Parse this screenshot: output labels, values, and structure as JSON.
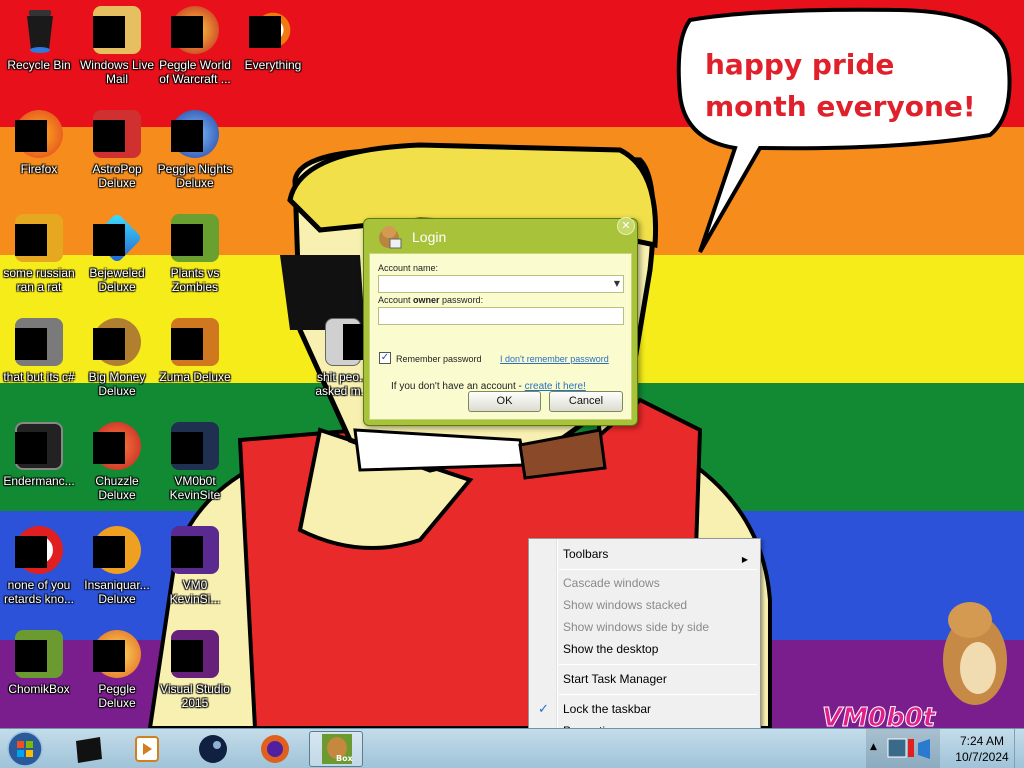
{
  "wallpaper": {
    "speech_bubble": "happy pride month everyone!",
    "watermark": "VM0b0t",
    "stripe_colors": [
      "#e8101a",
      "#f58c1c",
      "#f5ec1a",
      "#128a34",
      "#2b52d8",
      "#7a1e8e"
    ]
  },
  "desktop_icons": [
    {
      "label": "Recycle Bin",
      "icon": "recycle-bin-icon"
    },
    {
      "label": "Windows Live Mail",
      "icon": "windows-live-mail-icon"
    },
    {
      "label": "Peggle World of Warcraft ...",
      "icon": "peggle-wow-icon"
    },
    {
      "label": "Everything",
      "icon": "everything-search-icon"
    },
    {
      "label": "Firefox",
      "icon": "firefox-icon"
    },
    {
      "label": "AstroPop Deluxe",
      "icon": "astropop-icon"
    },
    {
      "label": "Peggle Nights Deluxe",
      "icon": "peggle-nights-icon"
    },
    {
      "label": "some russian ran a rat",
      "icon": "shortcut-icon"
    },
    {
      "label": "Bejeweled Deluxe",
      "icon": "bejeweled-icon"
    },
    {
      "label": "Plants vs Zombies",
      "icon": "plants-vs-zombies-icon"
    },
    {
      "label": "that but its c#",
      "icon": "shortcut-icon"
    },
    {
      "label": "Big Money Deluxe",
      "icon": "big-money-icon"
    },
    {
      "label": "Zuma Deluxe",
      "icon": "zuma-icon"
    },
    {
      "label": "Endermanc...",
      "icon": "console-icon"
    },
    {
      "label": "Chuzzle Deluxe",
      "icon": "chuzzle-icon"
    },
    {
      "label": "VM0b0t KevinSite",
      "icon": "website-icon"
    },
    {
      "label": "none of you retards kno...",
      "icon": "shortcut-icon"
    },
    {
      "label": "Insaniquar... Deluxe",
      "icon": "insaniquarium-icon"
    },
    {
      "label": "VM0 KevinSi...",
      "icon": "website-icon"
    },
    {
      "label": "ChomikBox",
      "icon": "chomikbox-icon"
    },
    {
      "label": "Peggle Deluxe",
      "icon": "peggle-icon"
    },
    {
      "label": "Visual Studio 2015",
      "icon": "visual-studio-icon"
    },
    {
      "label": "shit peo... asked m...",
      "icon": "folder-icon"
    }
  ],
  "login_dialog": {
    "title": "Login",
    "account_name_label": "Account name:",
    "account_name_value": "",
    "password_label_pre": "Account ",
    "password_label_bold": "owner",
    "password_label_post": " password:",
    "password_value": "",
    "remember_label": "Remember password",
    "remember_checked": true,
    "forgot_link": "I don't remember password",
    "no_account_text": "If you don't have an account - ",
    "create_link": "create it here!",
    "ok": "OK",
    "cancel": "Cancel"
  },
  "context_menu": {
    "items": [
      {
        "label": "Toolbars",
        "enabled": true,
        "submenu": true
      },
      {
        "label": "Cascade windows",
        "enabled": false
      },
      {
        "label": "Show windows stacked",
        "enabled": false
      },
      {
        "label": "Show windows side by side",
        "enabled": false
      },
      {
        "label": "Show the desktop",
        "enabled": true
      },
      {
        "label": "Start Task Manager",
        "enabled": true
      },
      {
        "label": "Lock the taskbar",
        "enabled": true,
        "checked": true
      },
      {
        "label": "Properties",
        "enabled": true
      }
    ]
  },
  "taskbar": {
    "pinned": [
      "cmd-icon",
      "media-player-icon",
      "steam-icon",
      "firefox-icon",
      "chomikbox-icon"
    ],
    "active_button_label": "Box",
    "clock_time": "7:24 AM",
    "clock_date": "10/7/2024"
  }
}
